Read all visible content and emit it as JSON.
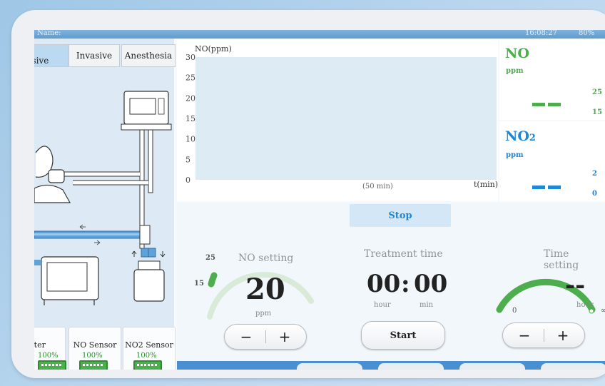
{
  "status": {
    "app_title": "Name:",
    "time": "16:08:27",
    "battery": "80%"
  },
  "tabs": [
    {
      "label": "Non-invasive",
      "active": true
    },
    {
      "label": "Invasive",
      "active": false
    },
    {
      "label": "Anesthesia",
      "active": false
    }
  ],
  "sensors": [
    {
      "name": "Filter",
      "pct": "100%"
    },
    {
      "name": "NO Sensor",
      "pct": "100%"
    },
    {
      "name": "NO2 Sensor",
      "pct": "100%"
    }
  ],
  "chart_data": {
    "type": "area",
    "title": "",
    "ylabel": "NO(ppm)",
    "xlabel": "t(min)",
    "x_range_label": "(50 min)",
    "ylim": [
      0,
      30
    ],
    "yticks": [
      0,
      5,
      10,
      15,
      20,
      25,
      30
    ],
    "series": [],
    "grid": false
  },
  "no_readout": {
    "title": "NO",
    "unit": "ppm",
    "value": "--",
    "upper_limit": "25",
    "lower_limit": "15",
    "color": "#4cae4c"
  },
  "no2_readout": {
    "title": "NO",
    "title_sub": "2",
    "unit": "ppm",
    "value": "--",
    "upper_limit": "2",
    "lower_limit": "0",
    "color": "#1e88d8"
  },
  "controls": {
    "stop_label": "Stop",
    "no_setting": {
      "label": "NO setting",
      "value": "20",
      "unit": "ppm",
      "gauge_upper": "25",
      "gauge_lower": "15"
    },
    "treatment_time": {
      "label": "Treatment time",
      "hours": "00",
      "sep": ":",
      "minutes": "00",
      "hour_label": "hour",
      "min_label": "min",
      "start_label": "Start"
    },
    "time_setting": {
      "label": "Time setting",
      "value": "--",
      "unit": "hour",
      "gauge_min": "0",
      "gauge_max": "∞"
    },
    "minus": "−",
    "plus": "+"
  }
}
